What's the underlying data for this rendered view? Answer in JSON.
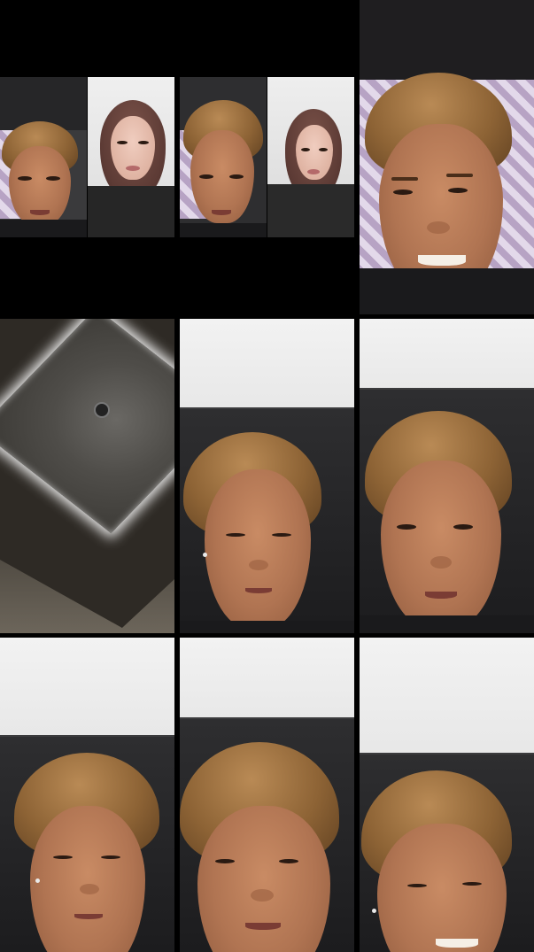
{
  "grid": {
    "rows": 3,
    "columns": 3,
    "tiles": [
      {
        "row": 1,
        "column": 1,
        "content": "video-call-duo"
      },
      {
        "row": 1,
        "column": 2,
        "content": "video-call-duo"
      },
      {
        "row": 1,
        "column": 3,
        "content": "selfie-smiling"
      },
      {
        "row": 2,
        "column": 1,
        "content": "ceiling-light"
      },
      {
        "row": 2,
        "column": 2,
        "content": "selfie-looking-down"
      },
      {
        "row": 2,
        "column": 3,
        "content": "selfie"
      },
      {
        "row": 3,
        "column": 1,
        "content": "selfie-looking-down"
      },
      {
        "row": 3,
        "column": 2,
        "content": "selfie-looking-down"
      },
      {
        "row": 3,
        "column": 3,
        "content": "selfie-smiling"
      }
    ]
  },
  "colors": {
    "background": "#000000",
    "hair": "#8d6335",
    "skin": "#b07452",
    "hijab": "#5d3b35",
    "headboard": "#1c1c1e",
    "wall": "#eeeeee"
  }
}
